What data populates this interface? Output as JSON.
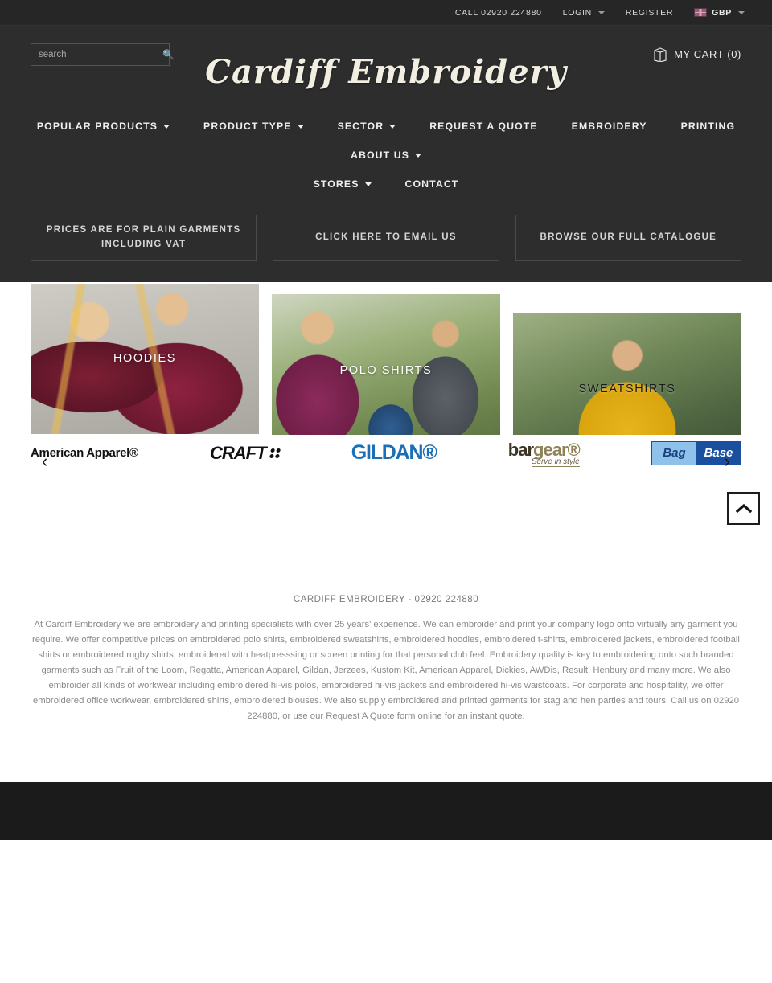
{
  "topbar": {
    "phone": "CALL 02920 224880",
    "login": "LOGIN",
    "register": "REGISTER",
    "currency": "GBP"
  },
  "header": {
    "logo": "Cardiff Embroidery",
    "cart_label": "MY CART (0)",
    "search_placeholder": "search",
    "search_value": ""
  },
  "nav": {
    "row1": [
      {
        "label": "POPULAR PRODUCTS",
        "has_caret": true
      },
      {
        "label": "PRODUCT TYPE",
        "has_caret": true
      },
      {
        "label": "SECTOR",
        "has_caret": true
      },
      {
        "label": "REQUEST A QUOTE",
        "has_caret": false
      },
      {
        "label": "EMBROIDERY",
        "has_caret": false
      },
      {
        "label": "PRINTING",
        "has_caret": false
      },
      {
        "label": "ABOUT US",
        "has_caret": true
      }
    ],
    "row2": [
      {
        "label": "STORES",
        "has_caret": true
      },
      {
        "label": "CONTACT",
        "has_caret": false
      }
    ]
  },
  "cta": {
    "prices": "PRICES ARE FOR PLAIN GARMENTS INCLUDING VAT",
    "email": "CLICK HERE TO EMAIL US",
    "catalogue": "BROWSE OUR FULL CATALOGUE"
  },
  "slider": {
    "tiles": [
      {
        "label": "HOODIES",
        "style": "light"
      },
      {
        "label": "POLO SHIRTS",
        "style": "light"
      },
      {
        "label": "SWEATSHIRTS",
        "style": "dark"
      }
    ],
    "prev_icon": "‹",
    "next_icon": "›"
  },
  "brands": [
    {
      "name": "American Apparel®"
    },
    {
      "name": "CRAFT"
    },
    {
      "name": "GILDAN®"
    },
    {
      "name": "bargear",
      "tagline": "Serve in style"
    },
    {
      "name": "Bag Base",
      "part1": "Bag",
      "part2": "Base"
    }
  ],
  "footer": {
    "title": "CARDIFF EMBROIDERY - 02920 224880",
    "body": "At Cardiff Embroidery we are embroidery and printing specialists with over 25 years' experience. We can embroider and print your company logo onto virtually any garment you require. We offer competitive prices on embroidered polo shirts, embroidered sweatshirts, embroidered hoodies, embroidered t-shirts, embroidered jackets, embroidered football shirts or embroidered rugby shirts, embroidered with heatpresssing or screen printing for that personal club feel. Embroidery quality is key to embroidering onto such branded garments such as Fruit of the Loom, Regatta, American Apparel, Gildan, Jerzees, Kustom Kit, American Apparel, Dickies, AWDis, Result, Henbury and many more. We also embroider all kinds of workwear including embroidered hi-vis polos, embroidered hi-vis jackets and embroidered hi-vis waistcoats. For corporate and hospitality, we offer embroidered office workwear, embroidered shirts, embroidered blouses. We also supply embroidered and printed garments for stag and hen parties and tours. Call us on 02920 224880, or use our Request A Quote form online for an instant quote."
  },
  "colors": {
    "header_bg": "#2d2d2d",
    "topbar_bg": "#262626",
    "footer_dark": "#1b1b1b",
    "accent_text": "#f0f0f0"
  }
}
